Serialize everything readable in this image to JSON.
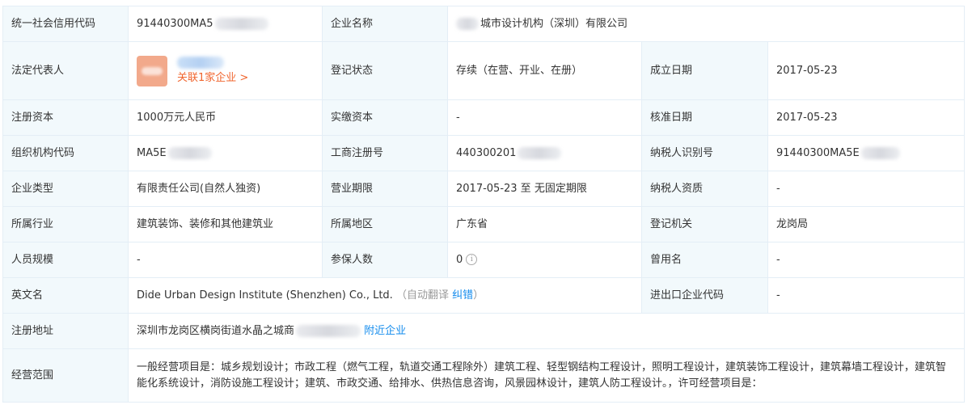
{
  "rows": {
    "credit_code": {
      "label": "统一社会信用代码",
      "value": "91440300MA5"
    },
    "company_name": {
      "label": "企业名称",
      "value": "城市设计机构（深圳）有限公司"
    },
    "legal_rep": {
      "label": "法定代表人",
      "related": "关联1家企业 >"
    },
    "reg_status": {
      "label": "登记状态",
      "value": "存续（在营、开业、在册）"
    },
    "founded": {
      "label": "成立日期",
      "value": "2017-05-23"
    },
    "reg_capital": {
      "label": "注册资本",
      "value": "1000万元人民币"
    },
    "paid_capital": {
      "label": "实缴资本",
      "value": "-"
    },
    "approved": {
      "label": "核准日期",
      "value": "2017-05-23"
    },
    "org_code": {
      "label": "组织机构代码",
      "value": "MA5E"
    },
    "biz_reg_no": {
      "label": "工商注册号",
      "value": "440300201"
    },
    "taxpayer_id": {
      "label": "纳税人识别号",
      "value": "91440300MA5E"
    },
    "company_type": {
      "label": "企业类型",
      "value": "有限责任公司(自然人独资)"
    },
    "biz_term": {
      "label": "营业期限",
      "value": "2017-05-23 至 无固定期限"
    },
    "taxpayer_qual": {
      "label": "纳税人资质",
      "value": "-"
    },
    "industry": {
      "label": "所属行业",
      "value": "建筑装饰、装修和其他建筑业"
    },
    "region": {
      "label": "所属地区",
      "value": "广东省"
    },
    "reg_authority": {
      "label": "登记机关",
      "value": "龙岗局"
    },
    "staff_size": {
      "label": "人员规模",
      "value": "-"
    },
    "insured": {
      "label": "参保人数",
      "value": "0"
    },
    "former_name": {
      "label": "曾用名",
      "value": "-"
    },
    "english_name": {
      "label": "英文名",
      "value": "Dide Urban Design Institute (Shenzhen) Co., Ltd.",
      "auto_translate": "（自动翻译",
      "correct": "纠错",
      "close_paren": "）"
    },
    "ie_code": {
      "label": "进出口企业代码",
      "value": "-"
    },
    "address": {
      "label": "注册地址",
      "value": "深圳市龙岗区横岗街道水晶之城商",
      "nearby": "附近企业"
    },
    "scope": {
      "label": "经营范围",
      "value": "一般经营项目是：城乡规划设计；市政工程（燃气工程，轨道交通工程除外）建筑工程、轻型钢结构工程设计，照明工程设计，建筑装饰工程设计，建筑幕墙工程设计，建筑智能化系统设计，消防设施工程设计；建筑、市政交通、给排水、供热信息咨询，风景园林设计，建筑人防工程设计。，许可经营项目是："
    }
  },
  "icons": {
    "insured_info": "info-circle-icon"
  },
  "colors": {
    "label_bg": "#f2f9fc",
    "border": "#e4eef6",
    "link_orange": "#f0652e",
    "link_blue": "#128bed"
  }
}
